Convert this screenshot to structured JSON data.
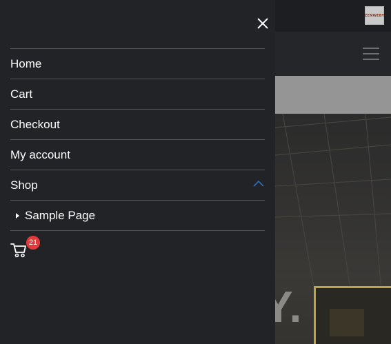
{
  "site": {
    "logo_text": "ZENWEBY",
    "hero_text": "Y."
  },
  "drawer": {
    "menu": [
      {
        "label": "Home"
      },
      {
        "label": "Cart"
      },
      {
        "label": "Checkout"
      },
      {
        "label": "My account"
      },
      {
        "label": "Shop",
        "expanded": true
      }
    ],
    "submenu": [
      {
        "label": "Sample Page"
      }
    ],
    "cart": {
      "count": "21",
      "badge_color": "#e2393b"
    },
    "accent_color": "#2f6fbd"
  }
}
